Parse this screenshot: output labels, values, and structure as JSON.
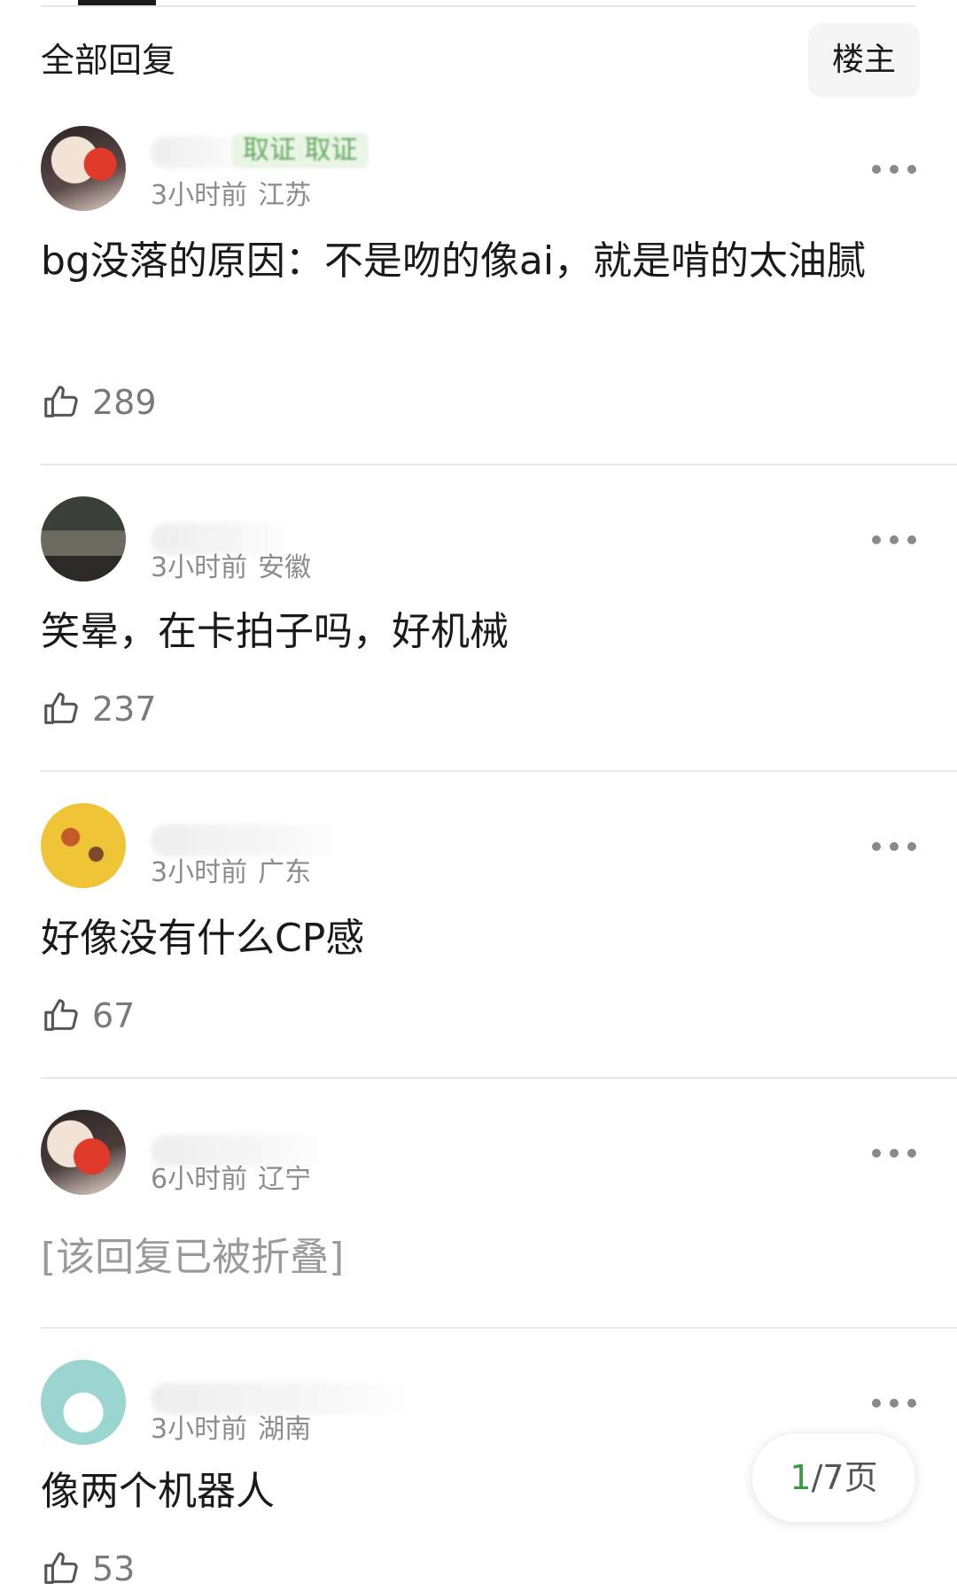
{
  "header": {
    "title": "全部回复",
    "filter_label": "楼主"
  },
  "comments": [
    {
      "badge": "取证 取证",
      "time": "3小时前",
      "location": "江苏",
      "text": "bg没落的原因：不是吻的像ai，就是啃的太油腻",
      "likes": "289"
    },
    {
      "time": "3小时前",
      "location": "安徽",
      "text": "笑晕，在卡拍子吗，好机械",
      "likes": "237"
    },
    {
      "time": "3小时前",
      "location": "广东",
      "text": "好像没有什么CP感",
      "likes": "67"
    },
    {
      "time": "6小时前",
      "location": "辽宁",
      "text": "[该回复已被折叠]"
    },
    {
      "time": "3小时前",
      "location": "湖南",
      "text": "像两个机器人",
      "likes": "53"
    }
  ],
  "pager": {
    "current": "1",
    "total_suffix": "/7页"
  },
  "colors": {
    "accent_green": "#3a9a44",
    "meta_gray": "#8c8c8c",
    "divider": "#e8e8e8"
  },
  "icons": {
    "like": "thumbs-up-icon",
    "more": "more-horizontal-icon"
  }
}
